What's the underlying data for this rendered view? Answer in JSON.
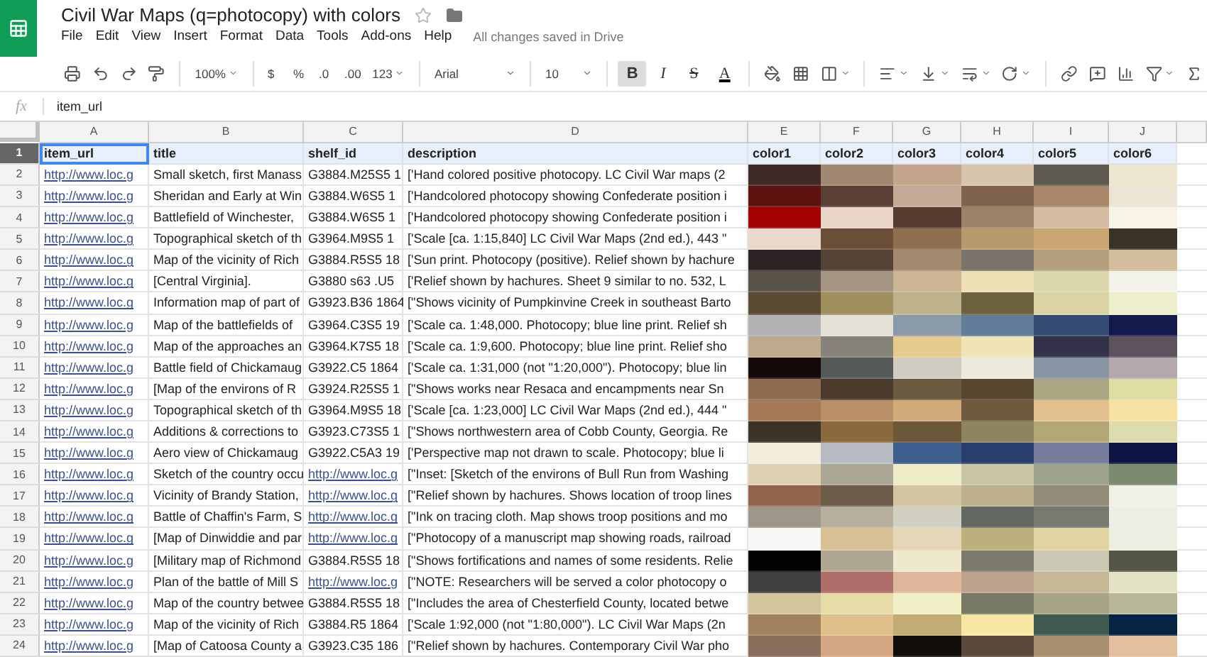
{
  "document": {
    "title": "Civil War Maps (q=photocopy) with colors",
    "starred": false
  },
  "menu": [
    "File",
    "Edit",
    "View",
    "Insert",
    "Format",
    "Data",
    "Tools",
    "Add-ons",
    "Help"
  ],
  "save_status": "All changes saved in Drive",
  "toolbar": {
    "zoom": "100%",
    "number_formats": [
      "$",
      "%",
      ".0",
      ".00",
      "123"
    ],
    "font": "Arial",
    "font_size": "10",
    "text_styles": [
      {
        "label": "B",
        "kind": "bold",
        "selected": true
      },
      {
        "label": "I",
        "kind": "italic",
        "selected": false
      },
      {
        "label": "S",
        "kind": "strike",
        "selected": false
      },
      {
        "label": "A",
        "kind": "color",
        "selected": false
      }
    ]
  },
  "formula_bar": {
    "label": "fx",
    "value": "item_url"
  },
  "columns": [
    "A",
    "B",
    "C",
    "D",
    "E",
    "F",
    "G",
    "H",
    "I",
    "J"
  ],
  "header_row": {
    "number": "1",
    "selected": true,
    "cells": [
      "item_url",
      "title",
      "shelf_id",
      "description",
      "color1",
      "color2",
      "color3",
      "color4",
      "color5",
      "color6"
    ]
  },
  "rows": [
    {
      "number": "2",
      "a": "http://www.loc.g",
      "b": "Small sketch, first Manass",
      "c": {
        "text": "G3884.M25S5 1",
        "kind": "text"
      },
      "d": "['Hand colored positive photocopy. LC Civil War maps (2",
      "colors": [
        {
          "color": "#3e2b26"
        },
        {
          "color": "#a08770"
        },
        {
          "color": "#c2a58b"
        },
        {
          "color": "#d6c4ae"
        },
        {
          "color": "#5e5a4f"
        },
        {
          "color": "#efe6cf"
        }
      ]
    },
    {
      "number": "3",
      "a": "http://www.loc.g",
      "b": "Sheridan and Early at Win",
      "c": {
        "text": "G3884.W6S5 1",
        "kind": "text"
      },
      "d": "['Handcolored photocopy showing Confederate position i",
      "colors": [
        {
          "color": "#5c130f"
        },
        {
          "color": "#5a4034"
        },
        {
          "color": "#c3ab98"
        },
        {
          "color": "#80634e"
        },
        {
          "color": "#a88869"
        },
        {
          "color": "#ece5d6"
        }
      ]
    },
    {
      "number": "4",
      "a": "http://www.loc.g",
      "b": "Battlefield of Winchester,",
      "c": {
        "text": "G3884.W6S5 1",
        "kind": "text"
      },
      "d": "['Handcolored photocopy showing Confederate position i",
      "colors": [
        {
          "color": "#a30000"
        },
        {
          "color": "#ead5c9"
        },
        {
          "color": "#553c2e"
        },
        {
          "color": "#9d826a"
        },
        {
          "color": "#d4bba2"
        },
        {
          "color": "#f7f3e5"
        }
      ]
    },
    {
      "number": "5",
      "a": "http://www.loc.g",
      "b": "Topographical sketch of th",
      "c": {
        "text": "G3964.M9S5 1",
        "kind": "text"
      },
      "d": "['Scale [ca. 1:15,840] LC Civil War Maps (2nd ed.), 443 \"",
      "colors": [
        {
          "color": "#e9d9cc"
        },
        {
          "color": "#6b4f38"
        },
        {
          "color": "#8e6e4f"
        },
        {
          "color": "#b89a6a"
        },
        {
          "color": "#c9a672"
        },
        {
          "color": "#3a3226"
        }
      ]
    },
    {
      "number": "6",
      "a": "http://www.loc.g",
      "b": "Map of the vicinity of Rich",
      "c": {
        "text": "G3884.R5S5 18",
        "kind": "text"
      },
      "d": "['Sun print. Photocopy (positive). Relief shown by hachure",
      "colors": [
        {
          "color": "#2c2424"
        },
        {
          "color": "#564337"
        },
        {
          "color": "#a38a6e"
        },
        {
          "color": "#7a736a"
        },
        {
          "color": "#b49f7d"
        },
        {
          "color": "#d4bf9c"
        }
      ]
    },
    {
      "number": "7",
      "a": "http://www.loc.g",
      "b": "[Central Virginia].",
      "c": {
        "text": "G3880 s63 .U5",
        "kind": "text"
      },
      "d": "['Relief shown by hachures. Sheet 9 similar to no. 532, L",
      "colors": [
        {
          "color": "#5b5347"
        },
        {
          "color": "#a49582"
        },
        {
          "color": "#cbb593"
        },
        {
          "color": "#ebdfb3"
        },
        {
          "color": "#ddd7ad"
        },
        {
          "color": "#f2f1ea"
        }
      ]
    },
    {
      "number": "8",
      "a": "http://www.loc.g",
      "b": "Information map of part of",
      "c": {
        "text": "G3923.B36 1864",
        "kind": "text"
      },
      "d": "[\"Shows vicinity of Pumpkinvine Creek in southeast Barto",
      "colors": [
        {
          "color": "#5b4a34"
        },
        {
          "color": "#a0905f"
        },
        {
          "color": "#bdb28a"
        },
        {
          "color": "#6c6240"
        },
        {
          "color": "#dad4a5"
        },
        {
          "color": "#f0efcd"
        }
      ]
    },
    {
      "number": "9",
      "a": "http://www.loc.g",
      "b": "Map of the battlefields of",
      "c": {
        "text": "G3964.C3S5 19",
        "kind": "text"
      },
      "d": "['Scale ca. 1:48,000. Photocopy; blue line print. Relief sh",
      "colors": [
        {
          "color": "#b0b2b4"
        },
        {
          "color": "#e3e1d5"
        },
        {
          "color": "#8a9aa8"
        },
        {
          "color": "#617c98"
        },
        {
          "color": "#364c72"
        },
        {
          "color": "#141a4c"
        }
      ]
    },
    {
      "number": "10",
      "a": "http://www.loc.g",
      "b": "Map of the approaches an",
      "c": {
        "text": "G3964.K7S5 18",
        "kind": "text"
      },
      "d": "['Scale ca. 1:9,600. Photocopy; blue line print. Relief sho",
      "colors": [
        {
          "color": "#bfa98c"
        },
        {
          "color": "#86847a"
        },
        {
          "color": "#e5cb8e"
        },
        {
          "color": "#efe4b6"
        },
        {
          "color": "#33324a"
        },
        {
          "color": "#5c535c"
        }
      ]
    },
    {
      "number": "11",
      "a": "http://www.loc.g",
      "b": "Battle field of Chickamaug",
      "c": {
        "text": "G3922.C5 1864",
        "kind": "text"
      },
      "d": "['Scale ca. 1:31,000 (not \"1:20,000\"). Photocopy; blue lin",
      "colors": [
        {
          "color": "#140808"
        },
        {
          "color": "#555a58"
        },
        {
          "color": "#cfcbc0"
        },
        {
          "color": "#eeeadb"
        },
        {
          "color": "#8795a2"
        },
        {
          "color": "#b5a8ad"
        }
      ]
    },
    {
      "number": "12",
      "a": "http://www.loc.g",
      "b": "[Map of the environs of R",
      "c": {
        "text": "G3924.R25S5 1",
        "kind": "text"
      },
      "d": "[\"Shows works near Resaca and encampments near Sn",
      "colors": [
        {
          "color": "#8e6b50"
        },
        {
          "color": "#4a3a2c"
        },
        {
          "color": "#6b5a40"
        },
        {
          "color": "#584730"
        },
        {
          "color": "#aca582"
        },
        {
          "color": "#dfdca4"
        }
      ]
    },
    {
      "number": "13",
      "a": "http://www.loc.g",
      "b": "Topographical sketch of th",
      "c": {
        "text": "G3964.M9S5 18",
        "kind": "text"
      },
      "d": "['Scale [ca. 1:23,000] LC Civil War Maps (2nd ed.), 444 \"",
      "colors": [
        {
          "color": "#a57b57"
        },
        {
          "color": "#b88f66"
        },
        {
          "color": "#d0aa79"
        },
        {
          "color": "#6e5a3c"
        },
        {
          "color": "#e3c18e"
        },
        {
          "color": "#f7e2a2"
        }
      ]
    },
    {
      "number": "14",
      "a": "http://www.loc.g",
      "b": "Additions & corrections to",
      "c": {
        "text": "G3923.C73S5 1",
        "kind": "text"
      },
      "d": "[\"Shows northwestern area of Cobb County, Georgia. Re",
      "colors": [
        {
          "color": "#3c3428"
        },
        {
          "color": "#8a6a3c"
        },
        {
          "color": "#6b5838"
        },
        {
          "color": "#8e8460"
        },
        {
          "color": "#b3a875"
        },
        {
          "color": "#dedcae"
        }
      ]
    },
    {
      "number": "15",
      "a": "http://www.loc.g",
      "b": "Aero view of Chickamaug",
      "c": {
        "text": "G3922.C5A3 19",
        "kind": "text"
      },
      "d": "['Perspective map not drawn to scale. Photocopy; blue li",
      "colors": [
        {
          "color": "#f1ecdc"
        },
        {
          "color": "#b8bcc2"
        },
        {
          "color": "#3e5e8e"
        },
        {
          "color": "#2a3e6e"
        },
        {
          "color": "#767c9c"
        },
        {
          "color": "#0e1446"
        }
      ]
    },
    {
      "number": "16",
      "a": "http://www.loc.g",
      "b": "Sketch of the country occu",
      "c": {
        "text": "http://www.loc.g",
        "kind": "link"
      },
      "d": "[\"Inset: [Sketch of the environs of Bull Run from Washing",
      "colors": [
        {
          "color": "#ddd1b2"
        },
        {
          "color": "#aaa693"
        },
        {
          "color": "#eeebc6"
        },
        {
          "color": "#c9c5a3"
        },
        {
          "color": "#9ca38a"
        },
        {
          "color": "#7c8a70"
        }
      ]
    },
    {
      "number": "17",
      "a": "http://www.loc.g",
      "b": "Vicinity of Brandy Station,",
      "c": {
        "text": "http://www.loc.g",
        "kind": "link"
      },
      "d": "[\"Relief shown by hachures. Shows location of troop lines",
      "colors": [
        {
          "color": "#92664e"
        },
        {
          "color": "#6e5c4a"
        },
        {
          "color": "#d3c4a2"
        },
        {
          "color": "#bcb08e"
        },
        {
          "color": "#928b78"
        },
        {
          "color": "#eff0e6"
        }
      ]
    },
    {
      "number": "18",
      "a": "http://www.loc.g",
      "b": "Battle of Chaffin's Farm, S",
      "c": {
        "text": "http://www.loc.g",
        "kind": "link"
      },
      "d": "[\"Ink on tracing cloth. Map shows troop positions and mo",
      "colors": [
        {
          "color": "#9e968a"
        },
        {
          "color": "#b8ae9e"
        },
        {
          "color": "#d2d0c3"
        },
        {
          "color": "#636960"
        },
        {
          "color": "#767a70"
        },
        {
          "color": "#eeeee6"
        }
      ]
    },
    {
      "number": "19",
      "a": "http://www.loc.g",
      "b": "[Map of Dinwiddie and par",
      "c": {
        "text": "http://www.loc.g",
        "kind": "link"
      },
      "d": "[\"Photocopy of a manuscript map showing roads, railroad",
      "colors": [
        {
          "color": "#f7f7f6"
        },
        {
          "color": "#d9c196"
        },
        {
          "color": "#e4d6b6"
        },
        {
          "color": "#bcb07c"
        },
        {
          "color": "#e1d3a2"
        },
        {
          "color": "#eeede2"
        }
      ]
    },
    {
      "number": "20",
      "a": "http://www.loc.g",
      "b": "[Military map of Richmond",
      "c": {
        "text": "G3884.R5S5 18",
        "kind": "text"
      },
      "d": "[\"Shows fortifications and names of some residents. Relie",
      "colors": [
        {
          "color": "#020202"
        },
        {
          "color": "#b0a792"
        },
        {
          "color": "#efe8cd"
        },
        {
          "color": "#7c7a6c"
        },
        {
          "color": "#cac8b3"
        },
        {
          "color": "#545748"
        }
      ]
    },
    {
      "number": "21",
      "a": "http://www.loc.g",
      "b": "Plan of the battle of Mill S",
      "c": {
        "text": "http://www.loc.g",
        "kind": "link"
      },
      "d": "[\"NOTE:  Researchers will be served a color photocopy o",
      "colors": [
        {
          "color": "#404040"
        },
        {
          "color": "#ae6e6a"
        },
        {
          "color": "#dfb89c"
        },
        {
          "color": "#c0a38c"
        },
        {
          "color": "#c6b896"
        },
        {
          "color": "#e4e2c5"
        }
      ]
    },
    {
      "number": "22",
      "a": "http://www.loc.g",
      "b": "Map of the country betwee",
      "c": {
        "text": "G3884.R5S5 18",
        "kind": "text"
      },
      "d": "[\"Includes the area of Chesterfield County, located betwe",
      "colors": [
        {
          "color": "#d5c59e"
        },
        {
          "color": "#e6dca8"
        },
        {
          "color": "#f1efc5"
        },
        {
          "color": "#787866"
        },
        {
          "color": "#a8a488"
        },
        {
          "color": "#b8b898"
        }
      ]
    },
    {
      "number": "23",
      "a": "http://www.loc.g",
      "b": "Map of the vicinity of Rich",
      "c": {
        "text": "G3884.R5 1864",
        "kind": "text"
      },
      "d": "['Scale 1:92,000 (not \"1:80,000\"). LC Civil War Maps (2n",
      "colors": [
        {
          "color": "#a0825c"
        },
        {
          "color": "#dfc08a"
        },
        {
          "color": "#c3ab74"
        },
        {
          "color": "#f6e8a2"
        },
        {
          "color": "#405a50"
        },
        {
          "color": "#052444"
        }
      ]
    },
    {
      "number": "24",
      "a": "http://www.loc.g",
      "b": "[Map of Catoosa County a",
      "c": {
        "text": "G3923.C35 186",
        "kind": "text"
      },
      "d": "[\"Relief shown by hachures. Contemporary Civil War pho",
      "colors": [
        {
          "color": "#8a6e5c"
        },
        {
          "color": "#d4a682"
        },
        {
          "color": "#140e0a"
        },
        {
          "color": "#5a4838"
        },
        {
          "color": "#a98e70"
        },
        {
          "color": "#e2c09e"
        }
      ]
    }
  ]
}
